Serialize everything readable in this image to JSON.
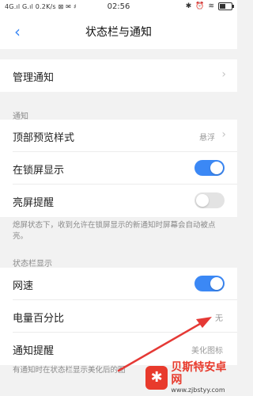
{
  "status_bar": {
    "left": "4G.ıl G.ıl 0.2K/s ⊠ ✉ ♯",
    "time": "02:56",
    "icons": [
      "bluetooth-icon",
      "alarm-icon",
      "wifi-icon",
      "battery-icon"
    ],
    "battery_level": 0.6
  },
  "nav": {
    "back_icon": "chevron-left-icon",
    "title": "状态栏与通知"
  },
  "manage": {
    "label": "管理通知"
  },
  "notifications": {
    "header": "通知",
    "top_preview": {
      "label": "顶部预览样式",
      "value": "悬浮"
    },
    "lockscreen": {
      "label": "在锁屏显示",
      "on": true
    },
    "wake": {
      "label": "亮屏提醒",
      "on": false
    },
    "note": "熄屏状态下，收到允许在锁屏显示的新通知时屏幕会自动被点亮。"
  },
  "status_display": {
    "header": "状态栏显示",
    "net_speed": {
      "label": "网速",
      "on": true
    },
    "battery_percent": {
      "label": "电量百分比",
      "value": "无"
    },
    "notify_style": {
      "label": "通知提醒",
      "value": "美化图标"
    },
    "note": "有通知时在状态栏显示美化后的图"
  },
  "colors": {
    "accent": "#3b88f5",
    "arrow": "#e53935"
  },
  "watermark": {
    "title": "贝斯特安卓网",
    "url": "www.zjbstyy.com"
  }
}
